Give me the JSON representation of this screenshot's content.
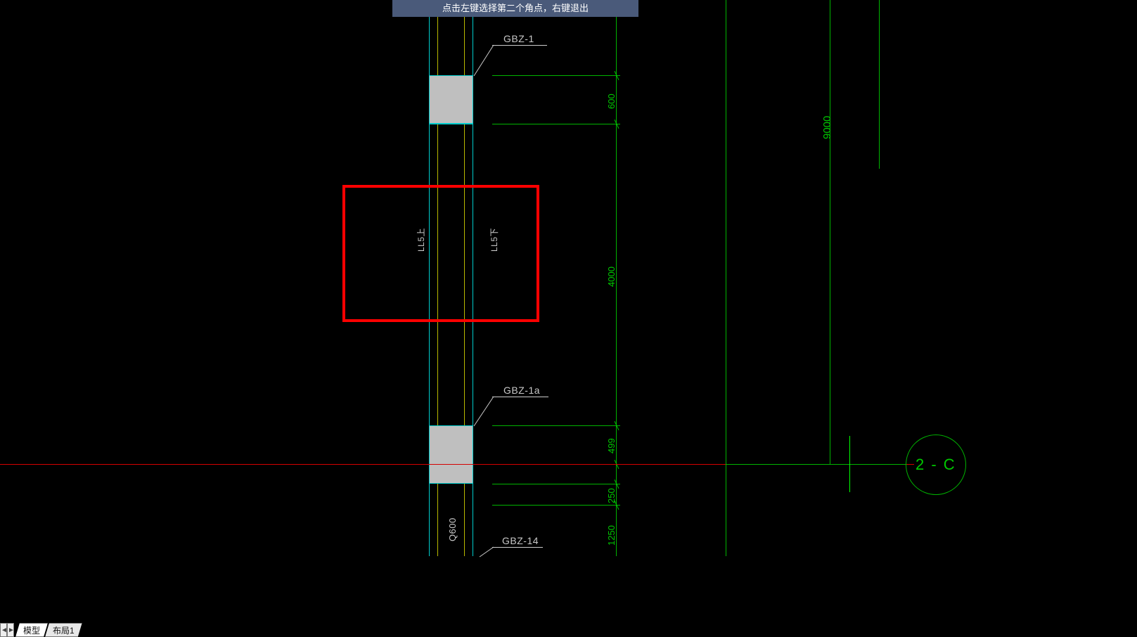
{
  "hint": "点击左键选择第二个角点，右键退出",
  "tabs": {
    "model": "模型",
    "layout1": "布局1"
  },
  "labels": {
    "gbz1": "GBZ-1",
    "gbz1a": "GBZ-1a",
    "gbz14": "GBZ-14",
    "ll5_up": "LL5上",
    "ll5_down": "LL5下",
    "q600": "Q600"
  },
  "dims": {
    "d600": "600",
    "d4000": "4000",
    "d499": "499",
    "d250": "250",
    "d1250": "1250",
    "d9000": "9000"
  },
  "grid": {
    "c2": "2 - C"
  }
}
